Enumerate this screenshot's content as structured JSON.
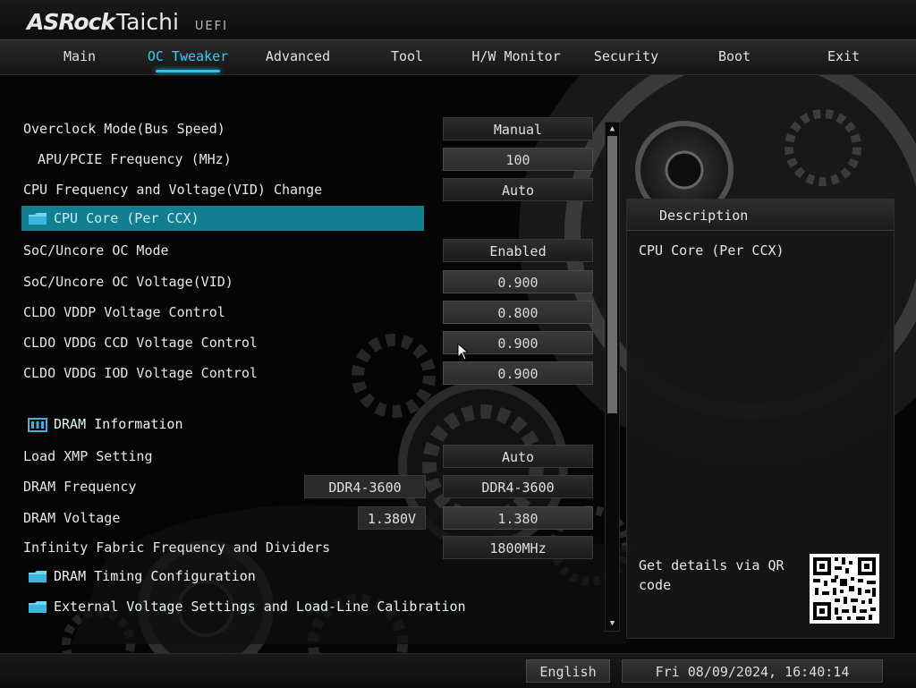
{
  "header": {
    "brand": "ASRock",
    "brand2": "Taichi",
    "uefi": "UEFI"
  },
  "nav": {
    "tabs": [
      {
        "label": "Main"
      },
      {
        "label": "OC Tweaker",
        "active": true
      },
      {
        "label": "Advanced"
      },
      {
        "label": "Tool"
      },
      {
        "label": "H/W Monitor"
      },
      {
        "label": "Security"
      },
      {
        "label": "Boot"
      },
      {
        "label": "Exit"
      }
    ]
  },
  "settings": {
    "overclock_mode": {
      "label": "Overclock Mode(Bus Speed)",
      "value": "Manual"
    },
    "apu_pcie": {
      "label": "APU/PCIE Frequency (MHz)",
      "value": "100"
    },
    "cpu_freq_vid": {
      "label": "CPU Frequency and Voltage(VID) Change",
      "value": "Auto"
    },
    "cpu_core": {
      "label": "CPU Core (Per CCX)"
    },
    "soc_oc_mode": {
      "label": "SoC/Uncore OC Mode",
      "value": "Enabled"
    },
    "soc_oc_voltage": {
      "label": "SoC/Uncore OC Voltage(VID)",
      "value": "0.900"
    },
    "cldo_vddp": {
      "label": "CLDO VDDP Voltage Control",
      "value": "0.800"
    },
    "cldo_vddg_ccd": {
      "label": "CLDO VDDG CCD Voltage Control",
      "value": "0.900"
    },
    "cldo_vddg_iod": {
      "label": "CLDO VDDG IOD Voltage Control",
      "value": "0.900"
    },
    "dram_info": {
      "label": "DRAM Information"
    },
    "load_xmp": {
      "label": "Load XMP Setting",
      "value": "Auto"
    },
    "dram_freq": {
      "label": "DRAM Frequency",
      "current": "DDR4-3600",
      "value": "DDR4-3600"
    },
    "dram_voltage": {
      "label": "DRAM Voltage",
      "current": "1.380V",
      "value": "1.380"
    },
    "infinity_fabric": {
      "label": "Infinity Fabric Frequency and Dividers",
      "value": "1800MHz"
    },
    "dram_timing": {
      "label": "DRAM Timing Configuration"
    },
    "ext_voltage": {
      "label": "External Voltage Settings and Load-Line Calibration"
    }
  },
  "description": {
    "title": "Description",
    "text": "CPU Core (Per CCX)",
    "qr_text": "Get details via QR code"
  },
  "footer": {
    "language": "English",
    "datetime": "Fri 08/09/2024, 16:40:14"
  },
  "colors": {
    "accent": "#29c6ee",
    "selected_row": "#127f91"
  }
}
